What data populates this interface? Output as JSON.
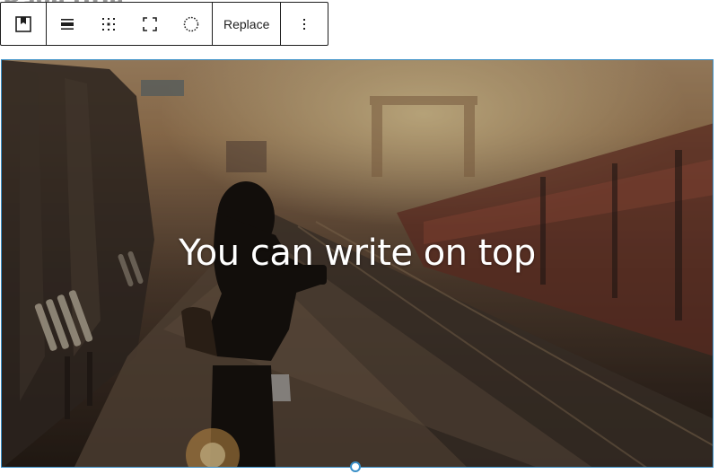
{
  "page": {
    "title": "Page title"
  },
  "toolbar": {
    "block_type_icon": "cover-block-icon",
    "buttons": [
      {
        "icon": "align-content-position-icon"
      },
      {
        "icon": "align-matrix-icon"
      },
      {
        "icon": "full-height-icon"
      },
      {
        "icon": "duotone-filter-icon"
      }
    ],
    "replace_label": "Replace",
    "more_icon": "more-vertical-icon"
  },
  "cover": {
    "text": "You can write on top",
    "text_color": "#ffffff",
    "overlay_color": "#000000",
    "selection_color": "#3a8fc7"
  }
}
